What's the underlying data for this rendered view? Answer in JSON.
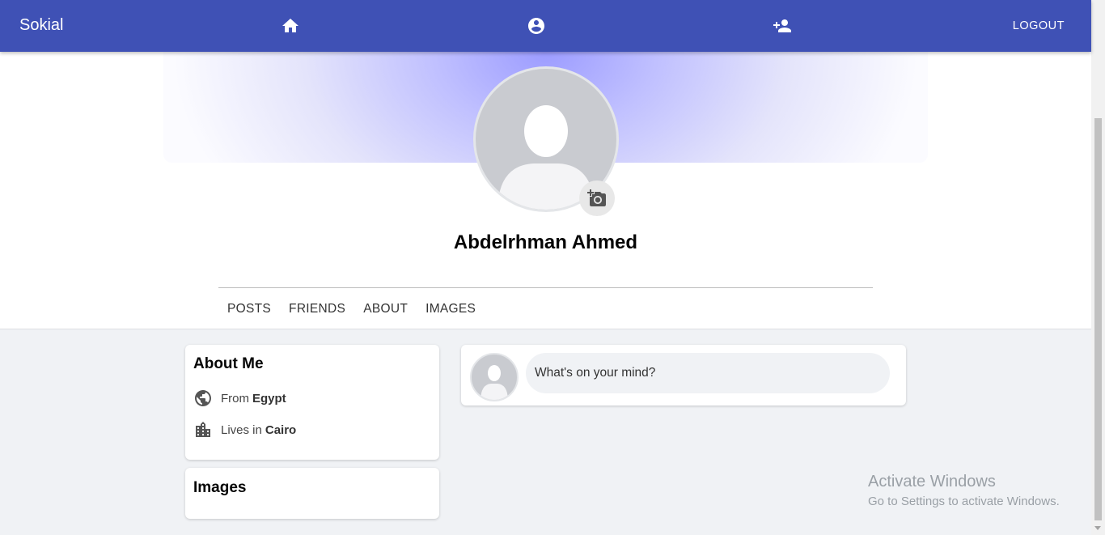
{
  "navbar": {
    "brand": "Sokial",
    "logout_label": "LOGOUT",
    "icons": [
      "home-icon",
      "account-circle-icon",
      "person-add-icon"
    ]
  },
  "profile": {
    "name": "Abdelrhman Ahmed",
    "tabs": [
      "POSTS",
      "FRIENDS",
      "ABOUT",
      "IMAGES"
    ]
  },
  "about": {
    "title": "About Me",
    "from_label": "From",
    "from_value": "Egypt",
    "lives_label": "Lives in",
    "lives_value": "Cairo"
  },
  "images": {
    "title": "Images"
  },
  "composer": {
    "placeholder": "What's on your mind?"
  },
  "watermark": {
    "title": "Activate Windows",
    "subtitle": "Go to Settings to activate Windows."
  },
  "colors": {
    "navbar": "#3f51b5",
    "background": "#f0f2f5",
    "avatar": "#c9cbd0"
  }
}
